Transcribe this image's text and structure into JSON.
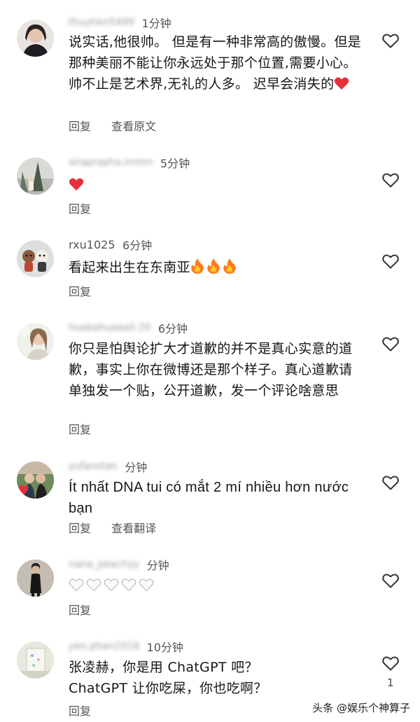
{
  "comments": [
    {
      "username": "thuytien5499",
      "time": "1分钟",
      "text": "说实话,他很帅。 但是有一种非常高的傲慢。但是那种美丽不能让你永远处于那个位置,需要小心。 帅不止是艺术界,无礼的人多。 迟早会消失的",
      "reply": "回复",
      "secondary_action": "查看原文"
    },
    {
      "username": "sirapraphа.mmm",
      "time": "5分钟",
      "text": "",
      "reply": "回复"
    },
    {
      "username": "rxu1025",
      "time": "6分钟",
      "text": "看起来出生在东南亚",
      "reply": "回复"
    },
    {
      "username": "huakahuaaa0.20",
      "time": "6分钟",
      "text": "你只是怕舆论扩大才道歉的并不是真心实意的道歉，事实上你在微博还是那个样子。真心道歉请单独发一个贴，公开道歉，发一个评论啥意思",
      "reply": "回复"
    },
    {
      "username": "yufanstan",
      "time": "分钟",
      "text": "Ít nhất DNA tui có mắt 2 mí nhiều hơn nước bạn",
      "reply": "回复",
      "secondary_action": "查看翻译"
    },
    {
      "username": "nana_peachyy",
      "time": "分钟",
      "text": "",
      "reply": "回复"
    },
    {
      "username": "yen.phan2018",
      "time": "10分钟",
      "text_line1": "张凌赫，你是用 ChatGPT 吧？",
      "text_line2": "ChatGPT 让你吃屎，你也吃啊？",
      "reply": "回复",
      "like_count": "1"
    }
  ],
  "icons": {
    "like": "heart-outline-icon",
    "red_heart": "red-heart-emoji",
    "fire": "fire-emoji",
    "white_heart": "white-heart-emoji"
  },
  "colors": {
    "red_heart": "#e8303a",
    "fire": "#ff7a1a",
    "muted_text": "#555555"
  },
  "watermark": "头条 @娱乐个神算子"
}
